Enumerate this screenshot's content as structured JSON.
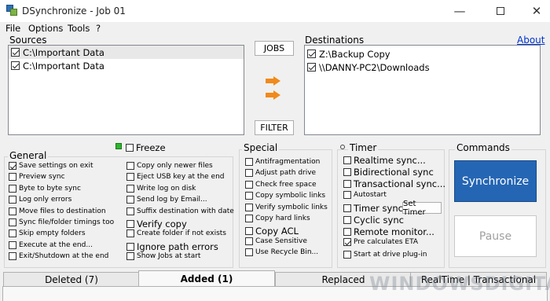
{
  "window": {
    "title": "DSynchronize - Job 01",
    "min_glyph": "—",
    "close_glyph": "✕"
  },
  "menu": [
    "File",
    "Options",
    "Tools",
    "?"
  ],
  "sources": {
    "label": "Sources",
    "items": [
      {
        "path": "C:\\Important Data",
        "checked": true
      },
      {
        "path": "C:\\Important Data",
        "checked": true
      }
    ]
  },
  "destinations": {
    "label": "Destinations",
    "about": "About",
    "items": [
      {
        "path": "Z:\\Backup Copy",
        "checked": true
      },
      {
        "path": "\\\\DANNY-PC2\\Downloads",
        "checked": true
      }
    ]
  },
  "buttons": {
    "jobs": "JOBS",
    "filter": "FILTER"
  },
  "freeze": {
    "label": "Freeze",
    "checked": false
  },
  "general": {
    "title": "General",
    "left": [
      {
        "label": "Save settings on exit",
        "checked": true
      },
      {
        "label": "Preview sync",
        "checked": false
      },
      {
        "label": "Byte to byte sync",
        "checked": false
      },
      {
        "label": "Log only errors",
        "checked": false
      },
      {
        "label": "Move files to destination",
        "checked": false
      },
      {
        "label": "Sync file/folder timings too",
        "checked": false
      },
      {
        "label": "Skip empty folders",
        "checked": false
      },
      {
        "label": "Execute at the end...",
        "checked": false
      },
      {
        "label": "Exit/Shutdown at the end",
        "checked": false
      }
    ],
    "right": [
      {
        "label": "Copy only newer files",
        "checked": false,
        "big": false
      },
      {
        "label": "Eject USB key at the end",
        "checked": false,
        "big": false
      },
      {
        "label": "Write log on disk",
        "checked": false,
        "big": false
      },
      {
        "label": "Send log by Email...",
        "checked": false,
        "big": false
      },
      {
        "label": "Suffix destination with date",
        "checked": false,
        "big": false
      },
      {
        "label": "Verify copy",
        "checked": false,
        "big": true
      },
      {
        "label": "Create folder if not exists",
        "checked": false,
        "big": false
      },
      {
        "label": "Ignore path errors",
        "checked": false,
        "big": true
      },
      {
        "label": "Show Jobs at start",
        "checked": false,
        "big": false
      }
    ]
  },
  "special": {
    "title": "Special",
    "items": [
      {
        "label": "Antifragmentation",
        "checked": false,
        "big": false
      },
      {
        "label": "Adjust path drive",
        "checked": false,
        "big": false
      },
      {
        "label": "Check free space",
        "checked": false,
        "big": false
      },
      {
        "label": "Copy symbolic links",
        "checked": false,
        "big": false
      },
      {
        "label": "Verify symbolic links",
        "checked": false,
        "big": false
      },
      {
        "label": "Copy hard links",
        "checked": false,
        "big": false
      },
      {
        "label": "Copy ACL",
        "checked": false,
        "big": true
      },
      {
        "label": "Case Sensitive",
        "checked": false,
        "big": false
      },
      {
        "label": "Use Recycle Bin...",
        "checked": false,
        "big": false
      }
    ]
  },
  "timer": {
    "title": "Timer",
    "set_timer": "Set Timer",
    "items": [
      {
        "label": "Realtime sync...",
        "checked": false,
        "big": true
      },
      {
        "label": "Bidirectional sync",
        "checked": false,
        "big": true
      },
      {
        "label": "Transactional sync...",
        "checked": false,
        "big": true
      },
      {
        "label": "Autostart",
        "checked": false,
        "big": false
      },
      {
        "label": "Timer sync",
        "checked": false,
        "big": true
      },
      {
        "label": "Cyclic sync",
        "checked": false,
        "big": true
      },
      {
        "label": "Remote monitor...",
        "checked": false,
        "big": true
      },
      {
        "label": "Pre calculates ETA",
        "checked": true,
        "big": false
      },
      {
        "label": "Start at drive plug-in",
        "checked": false,
        "big": false
      }
    ]
  },
  "commands": {
    "title": "Commands",
    "synchronize": "Synchronize",
    "pause": "Pause"
  },
  "tabs": [
    {
      "label": "Deleted (7)",
      "active": false
    },
    {
      "label": "Added (1)",
      "active": true
    },
    {
      "label": "Replaced",
      "active": false
    },
    {
      "label": "RealTime | Transactional",
      "active": false
    }
  ],
  "watermark": "WINDOWSDIGITAL.COM",
  "colors": {
    "accent": "#2566b4",
    "arrow": "#f08a1c",
    "freeze_led": "#2fb52f"
  }
}
